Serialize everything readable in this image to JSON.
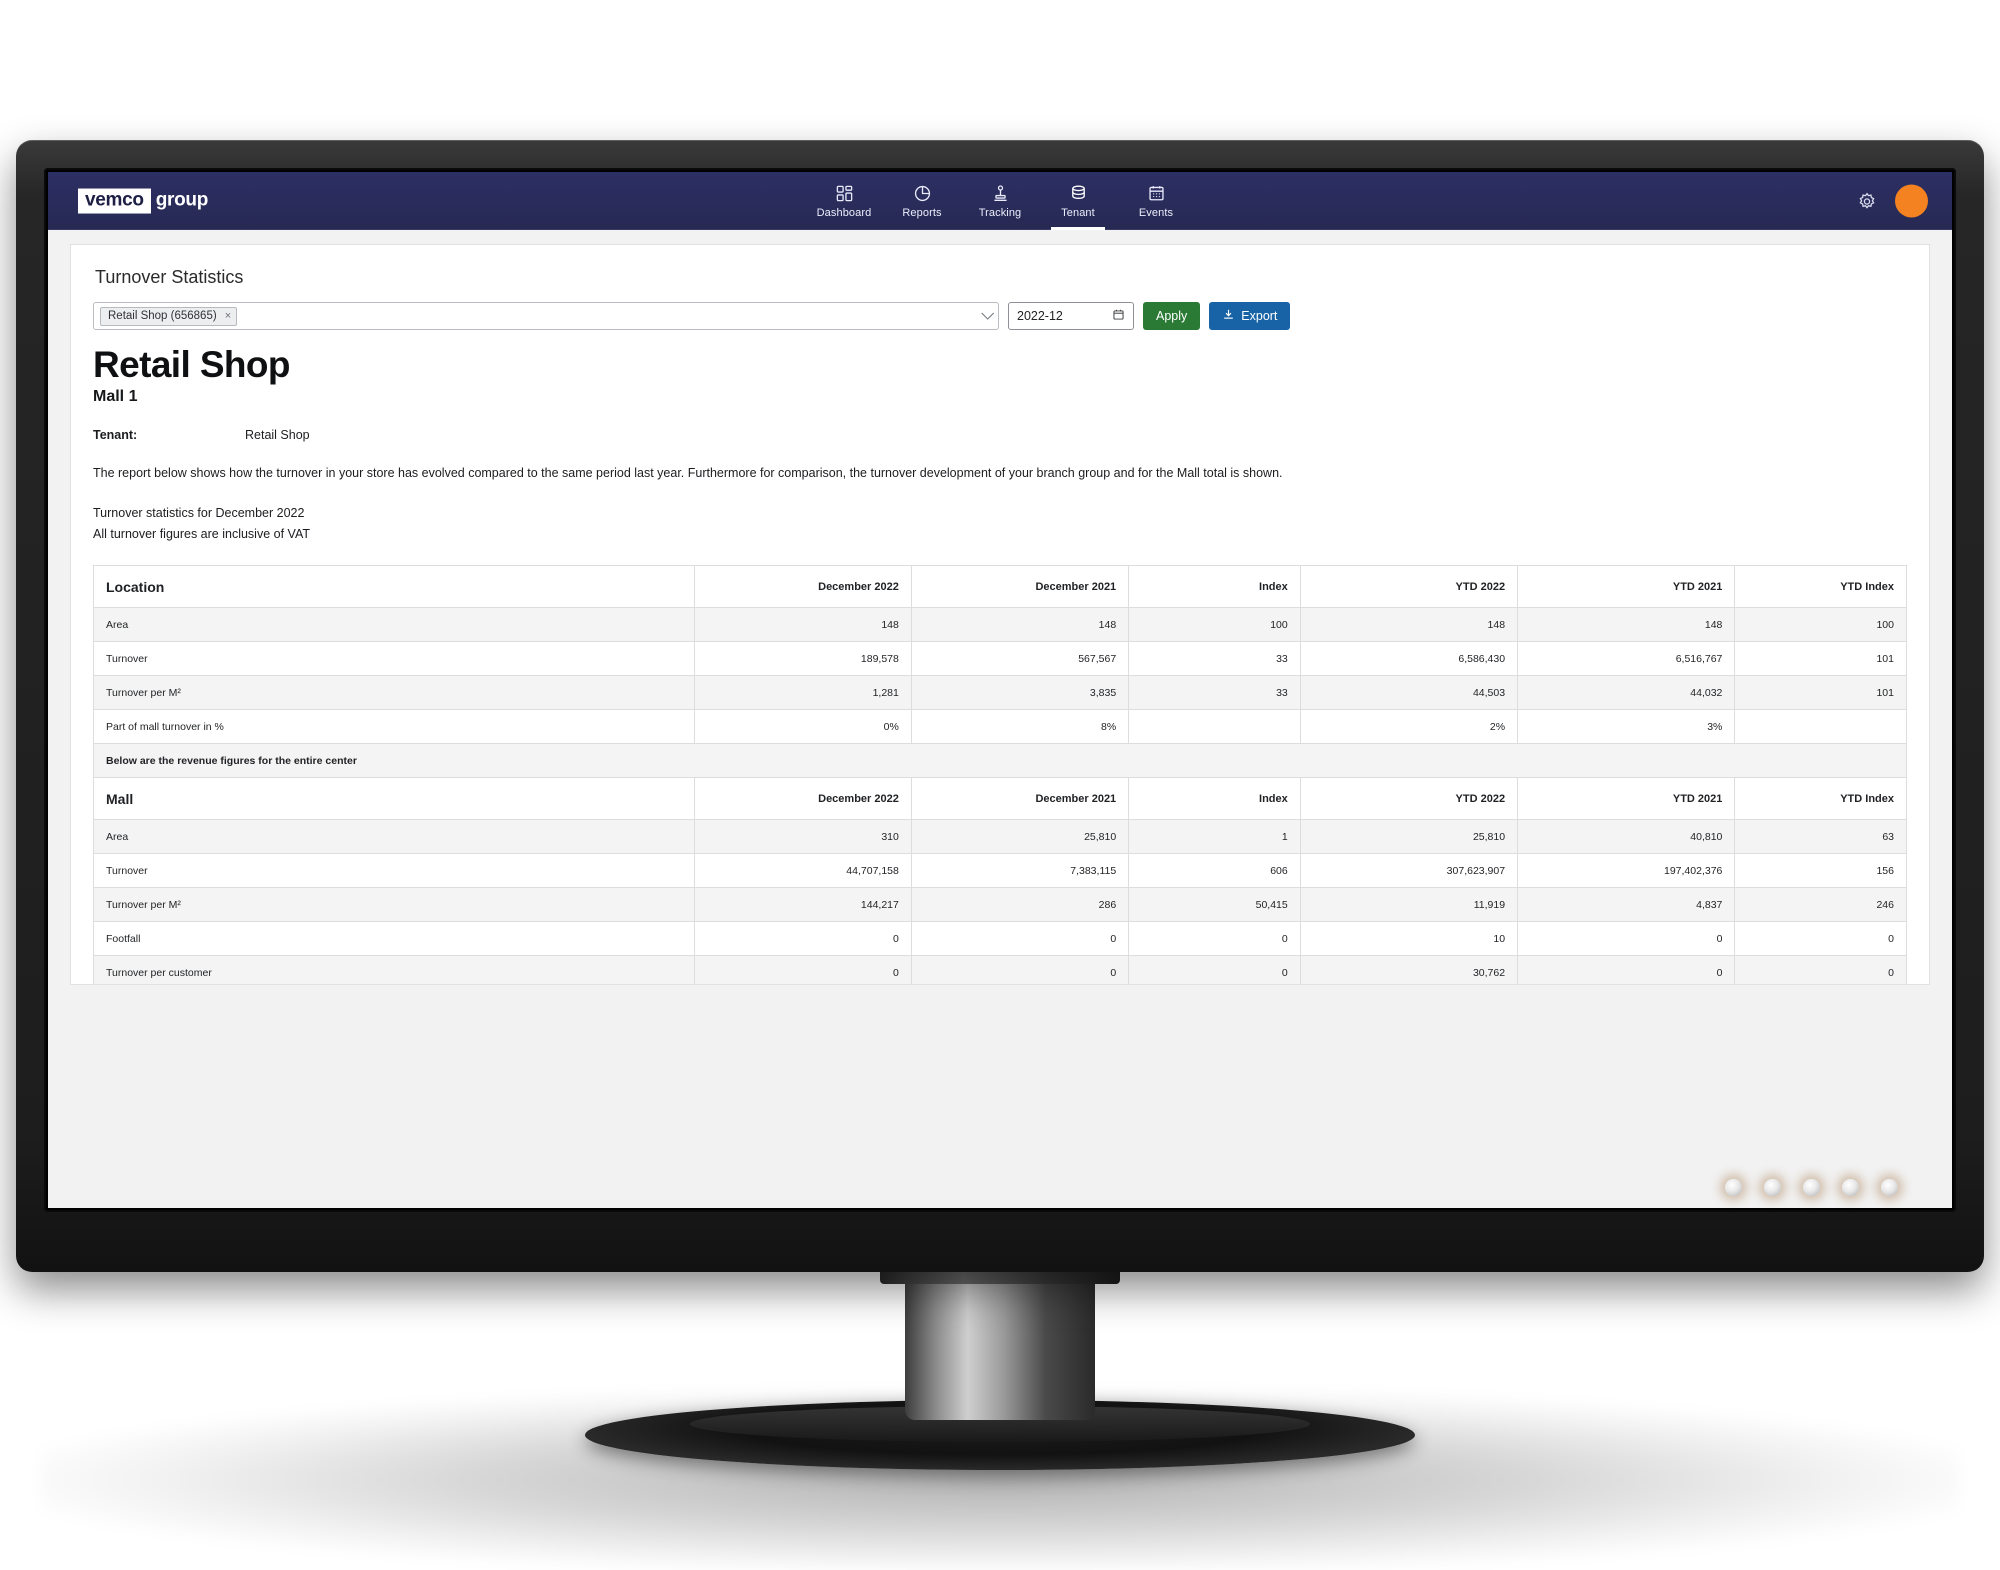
{
  "app": {
    "logo_box": "vemco",
    "logo_word": "group",
    "nav": [
      {
        "label": "Dashboard",
        "icon": "dashboard-icon",
        "active": false
      },
      {
        "label": "Reports",
        "icon": "pie-chart-icon",
        "active": false
      },
      {
        "label": "Tracking",
        "icon": "tracking-pin-icon",
        "active": false
      },
      {
        "label": "Tenant",
        "icon": "database-icon",
        "active": true
      },
      {
        "label": "Events",
        "icon": "calendar-icon",
        "active": false
      }
    ],
    "settings_icon": "gear-icon",
    "avatar_color": "#f58220"
  },
  "page": {
    "title": "Turnover Statistics",
    "report_title": "Retail Shop",
    "report_subtitle": "Mall 1",
    "tenant_label": "Tenant:",
    "tenant_value": "Retail Shop",
    "description": "The report below shows how the turnover in your store has evolved compared to the same period last year. Furthermore for comparison, the turnover development of your branch group and for the Mall total is shown.",
    "stats_line_1": "Turnover statistics for December 2022",
    "stats_line_2": "All turnover figures are inclusive of VAT"
  },
  "toolbar": {
    "tenant_tag": "Retail Shop (656865)",
    "tenant_tag_remove": "×",
    "tenant_select_placeholder": "",
    "date_value": "2022-12",
    "date_icon": "calendar-icon",
    "apply_label": "Apply",
    "export_label": "Export",
    "export_icon": "download-icon",
    "apply_color": "#2a7a35",
    "export_color": "#1763a6"
  },
  "tables": {
    "location": {
      "headers": [
        "Location",
        "December 2022",
        "December 2021",
        "Index",
        "YTD 2022",
        "YTD 2021",
        "YTD Index"
      ],
      "rows": [
        {
          "label": "Area",
          "values": [
            "148",
            "148",
            "100",
            "148",
            "148",
            "100"
          ]
        },
        {
          "label": "Turnover",
          "values": [
            "189,578",
            "567,567",
            "33",
            "6,586,430",
            "6,516,767",
            "101"
          ]
        },
        {
          "label": "Turnover per M²",
          "values": [
            "1,281",
            "3,835",
            "33",
            "44,503",
            "44,032",
            "101"
          ]
        },
        {
          "label": "Part of mall turnover in %",
          "values": [
            "0%",
            "8%",
            "",
            "2%",
            "3%",
            ""
          ]
        }
      ],
      "note": "Below are the revenue figures for the entire center"
    },
    "mall": {
      "headers": [
        "Mall",
        "December 2022",
        "December 2021",
        "Index",
        "YTD 2022",
        "YTD 2021",
        "YTD Index"
      ],
      "rows": [
        {
          "label": "Area",
          "values": [
            "310",
            "25,810",
            "1",
            "25,810",
            "40,810",
            "63"
          ]
        },
        {
          "label": "Turnover",
          "values": [
            "44,707,158",
            "7,383,115",
            "606",
            "307,623,907",
            "197,402,376",
            "156"
          ]
        },
        {
          "label": "Turnover per M²",
          "values": [
            "144,217",
            "286",
            "50,415",
            "11,919",
            "4,837",
            "246"
          ]
        },
        {
          "label": "Footfall",
          "values": [
            "0",
            "0",
            "0",
            "10",
            "0",
            "0"
          ]
        },
        {
          "label": "Turnover per customer",
          "values": [
            "0",
            "0",
            "0",
            "30,762",
            "0",
            "0"
          ]
        }
      ]
    }
  },
  "monitor": {
    "bezel_dots": 5
  }
}
